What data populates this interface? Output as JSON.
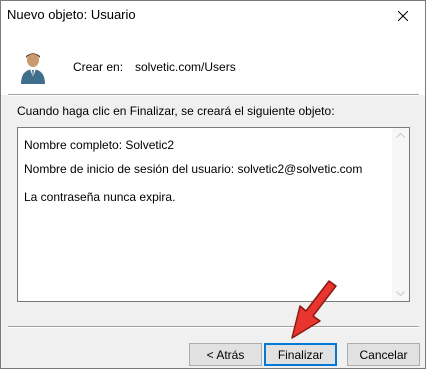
{
  "window": {
    "title": "Nuevo objeto: Usuario",
    "close_icon": "close-icon",
    "user_icon": "user-icon"
  },
  "header": {
    "create_in_label": "Crear en:",
    "create_in_value": "solvetic.com/Users"
  },
  "description": "Cuando haga clic en Finalizar, se creará el siguiente objeto:",
  "summary": {
    "lines": [
      "Nombre completo: Solvetic2",
      "Nombre de inicio de sesión del usuario: solvetic2@solvetic.com",
      "La contraseña nunca expira."
    ]
  },
  "buttons": {
    "back": "< Atrás",
    "finish": "Finalizar",
    "cancel": "Cancelar"
  },
  "annotation": {
    "arrow_color": "#e8352d",
    "arrow_icon": "red-arrow-icon"
  }
}
